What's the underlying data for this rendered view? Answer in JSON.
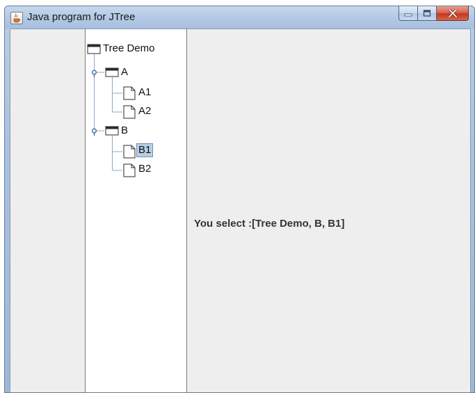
{
  "window": {
    "title": "Java program for JTree",
    "icon": "java-cup-icon",
    "controls": {
      "minimize": "minimize-icon",
      "maximize": "maximize-icon",
      "close": "close-icon"
    }
  },
  "tree": {
    "root": {
      "label": "Tree Demo",
      "icon": "folder-icon"
    },
    "nodes": [
      {
        "label": "A",
        "icon": "folder-icon",
        "expanded": true
      },
      {
        "label": "A1",
        "icon": "file-icon"
      },
      {
        "label": "A2",
        "icon": "file-icon"
      },
      {
        "label": "B",
        "icon": "folder-icon",
        "expanded": true
      },
      {
        "label": "B1",
        "icon": "file-icon",
        "selected": true
      },
      {
        "label": "B2",
        "icon": "file-icon"
      }
    ]
  },
  "status": {
    "text": "You select :[Tree Demo, B, B1]"
  },
  "colors": {
    "selection_bg": "#b8cfe5",
    "tree_line": "#8fa8c8",
    "client_bg": "#eeeeee"
  }
}
